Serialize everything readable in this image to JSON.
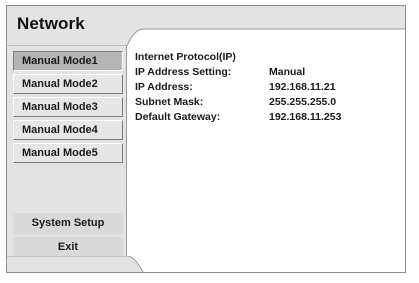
{
  "window": {
    "title": "Network"
  },
  "sidebar": {
    "modes": [
      {
        "label": "Manual Mode1",
        "selected": true
      },
      {
        "label": "Manual Mode2",
        "selected": false
      },
      {
        "label": "Manual Mode3",
        "selected": false
      },
      {
        "label": "Manual Mode4",
        "selected": false
      },
      {
        "label": "Manual Mode5",
        "selected": false
      }
    ],
    "system_setup_label": "System Setup",
    "exit_label": "Exit"
  },
  "details": {
    "heading": "Internet Protocol(IP)",
    "rows": [
      {
        "label": "IP Address Setting:",
        "value": "Manual"
      },
      {
        "label": "IP Address:",
        "value": "192.168.11.21"
      },
      {
        "label": "Subnet Mask:",
        "value": "255.255.255.0"
      },
      {
        "label": "Default Gateway:",
        "value": "192.168.11.253"
      }
    ]
  },
  "colors": {
    "frame_border": "#8c8c8c",
    "panel_gray": "#e3e3e3",
    "selected_button": "#b5b5b5",
    "text": "#1a1a1a"
  }
}
